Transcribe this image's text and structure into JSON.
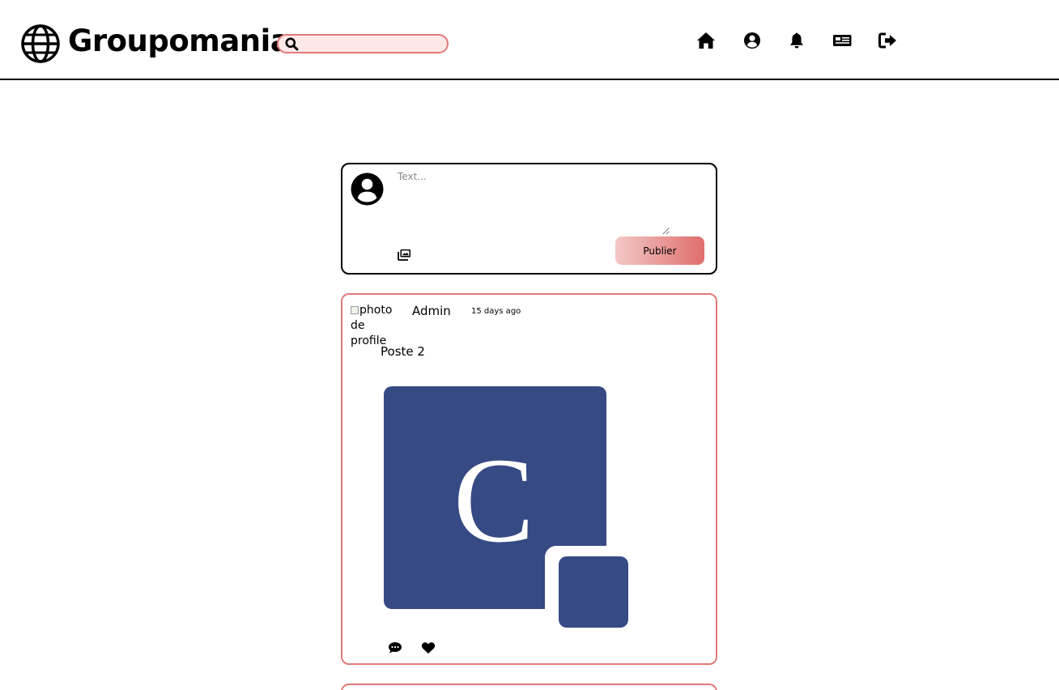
{
  "header": {
    "brand": "Groupomania",
    "logo_icon": "globe-icon",
    "search": {
      "placeholder": "",
      "value": "",
      "icon": "search-icon",
      "accent_color": "#e07a78",
      "bg_color": "#fde8e7"
    },
    "nav": [
      {
        "name": "home",
        "icon": "home-icon"
      },
      {
        "name": "profile",
        "icon": "user-circle-icon"
      },
      {
        "name": "notifications",
        "icon": "bell-icon"
      },
      {
        "name": "news",
        "icon": "newspaper-icon"
      },
      {
        "name": "logout",
        "icon": "sign-out-icon"
      }
    ]
  },
  "composer": {
    "placeholder": "Text...",
    "value": "",
    "publish_label": "Publier",
    "image_icon": "images-icon",
    "avatar_icon": "user-circle-icon"
  },
  "posts": [
    {
      "author": "Admin",
      "time": "15 days ago",
      "avatar_alt": "photo de profile",
      "text": "Poste 2",
      "image_letter": "C",
      "image_color": "#364a84",
      "actions": {
        "comment_icon": "comment-icon",
        "like_icon": "heart-icon"
      }
    }
  ],
  "colors": {
    "accent": "#e07a78",
    "image_blue": "#364a84"
  }
}
